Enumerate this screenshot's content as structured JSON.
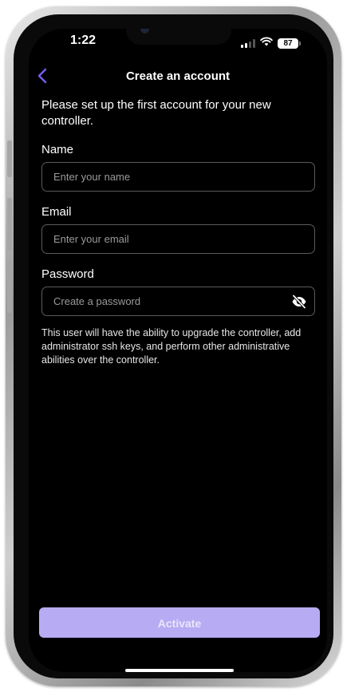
{
  "status_bar": {
    "time": "1:22",
    "battery": "87",
    "icons": [
      "signal-icon",
      "wifi-icon",
      "battery-icon"
    ]
  },
  "header": {
    "back_icon": "chevron-left-icon",
    "title": "Create an account"
  },
  "intro_text": "Please set up the first account for your new controller.",
  "form": {
    "name": {
      "label": "Name",
      "placeholder": "Enter your name",
      "value": ""
    },
    "email": {
      "label": "Email",
      "placeholder": "Enter your email",
      "value": ""
    },
    "password": {
      "label": "Password",
      "placeholder": "Create a password",
      "value": "",
      "toggle_icon": "eye-off-icon"
    }
  },
  "helper_text": "This user will have the ability to upgrade the controller, add administrator ssh keys, and perform other administrative abilities over the controller.",
  "activate_button": {
    "label": "Activate",
    "enabled": false
  },
  "colors": {
    "accent": "#7b5cf0",
    "button_disabled": "#b7abf3",
    "background": "#000000",
    "field_border": "#5b5b5b"
  }
}
